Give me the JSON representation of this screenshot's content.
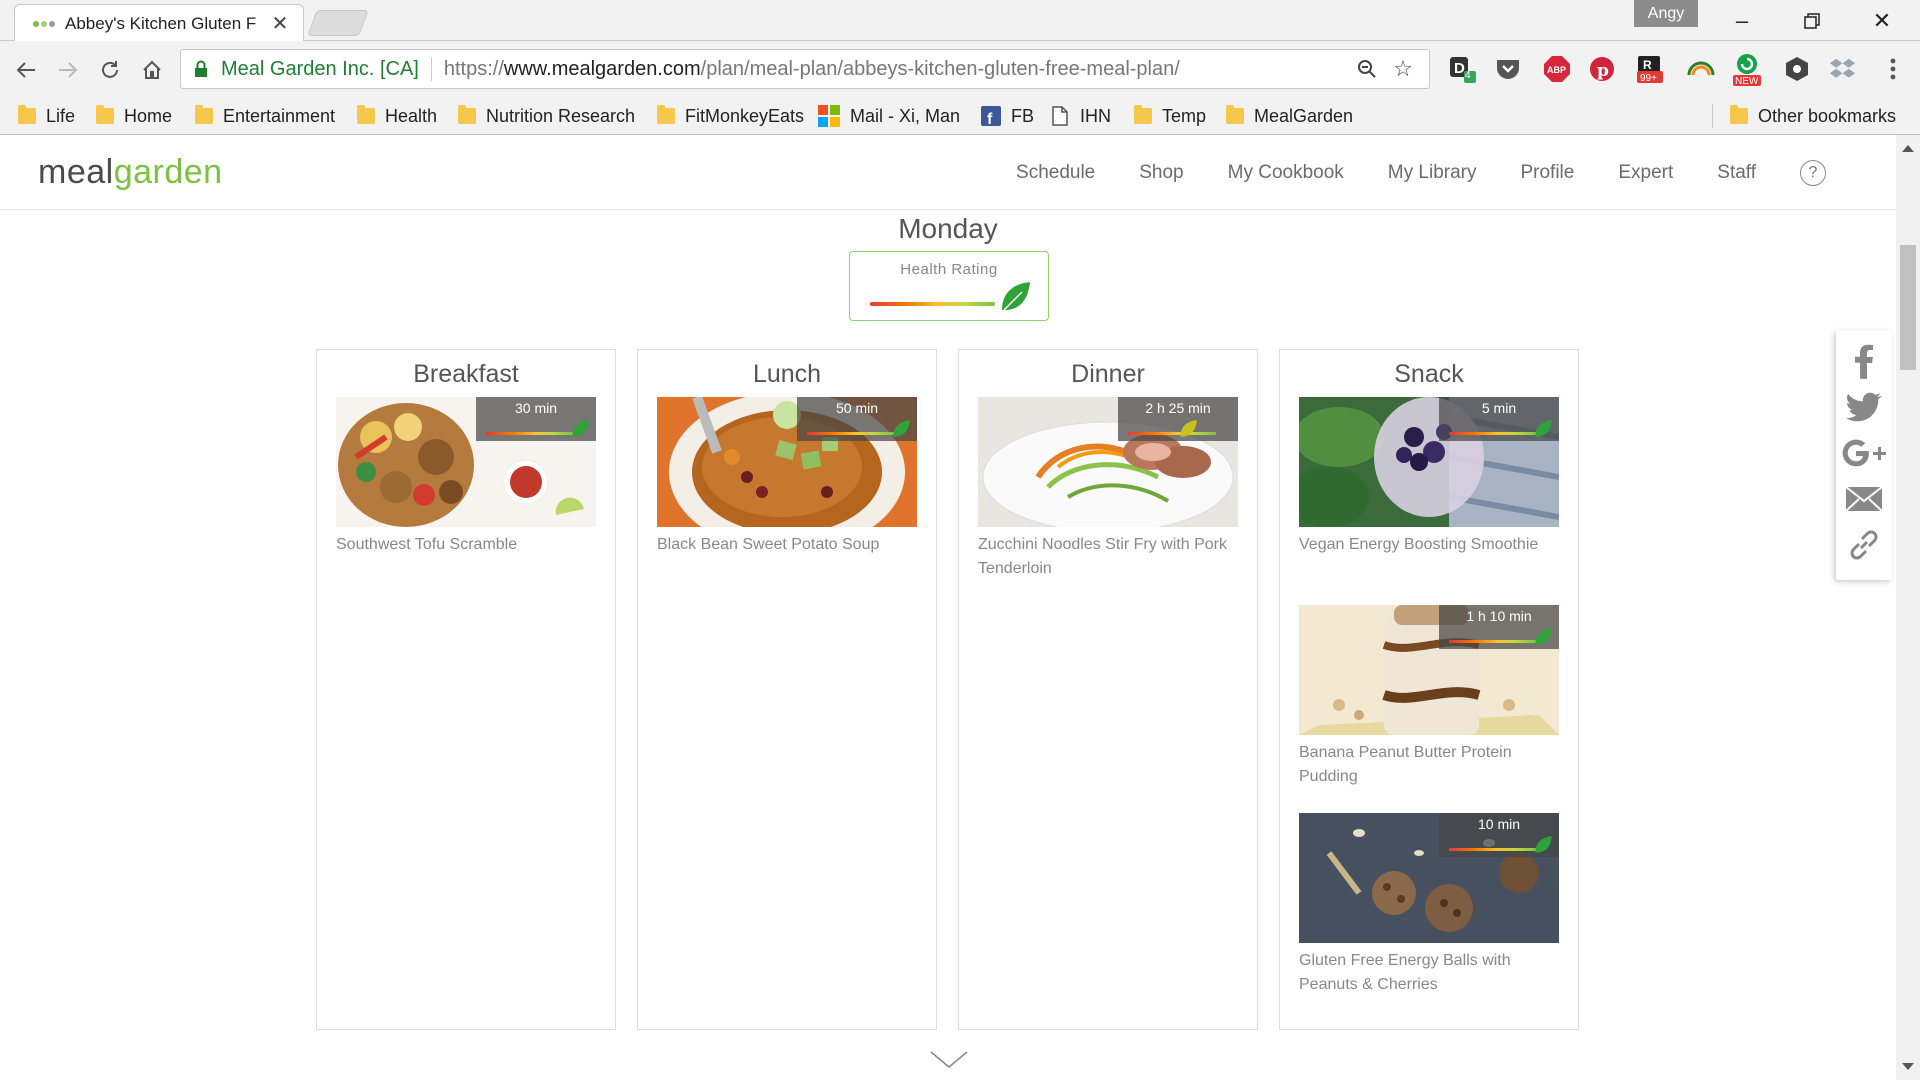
{
  "browser": {
    "tab_title": "Abbey's Kitchen Gluten F",
    "profile_name": "Angy",
    "secure_label": "Meal Garden Inc. [CA]",
    "url_scheme": "https://",
    "url_host": "www.mealgarden.com",
    "url_path": "/plan/meal-plan/abbeys-kitchen-gluten-free-meal-plan/",
    "extension_badges": {
      "d_badge": "4",
      "feedly_badge": "99+",
      "new_badge": "NEW"
    },
    "bookmarks": [
      "Life",
      "Home",
      "Entertainment",
      "Health",
      "Nutrition Research",
      "FitMonkeyEats",
      "Mail - Xi, Man",
      "FB",
      "IHN",
      "Temp",
      "MealGarden"
    ],
    "other_bookmarks": "Other bookmarks"
  },
  "site": {
    "logo_part1": "meal",
    "logo_part2": "garden",
    "nav": [
      "Schedule",
      "Shop",
      "My Cookbook",
      "My Library",
      "Profile",
      "Expert",
      "Staff"
    ],
    "help_label": "?"
  },
  "day": {
    "title": "Monday",
    "health_label": "Health Rating"
  },
  "meals": [
    {
      "name": "Breakfast",
      "recipes": [
        {
          "title": "Southwest Tofu Scramble",
          "time": "30 min"
        }
      ]
    },
    {
      "name": "Lunch",
      "recipes": [
        {
          "title": "Black Bean Sweet Potato Soup",
          "time": "50 min"
        }
      ]
    },
    {
      "name": "Dinner",
      "recipes": [
        {
          "title": "Zucchini Noodles Stir Fry with Pork Tenderloin",
          "time": "2 h 25 min"
        }
      ]
    },
    {
      "name": "Snack",
      "recipes": [
        {
          "title": "Vegan Energy Boosting Smoothie",
          "time": "5 min"
        },
        {
          "title": "Banana Peanut Butter Protein Pudding",
          "time": "1 h 10 min"
        },
        {
          "title": "Gluten Free Energy Balls with Peanuts & Cherries",
          "time": "10 min"
        }
      ]
    }
  ],
  "colors": {
    "brand_green": "#7cc242",
    "logo_gray": "#4a4a4a",
    "secure_green": "#1e7f32"
  },
  "share": [
    "facebook-icon",
    "twitter-icon",
    "google-plus-icon",
    "email-icon",
    "link-icon"
  ]
}
